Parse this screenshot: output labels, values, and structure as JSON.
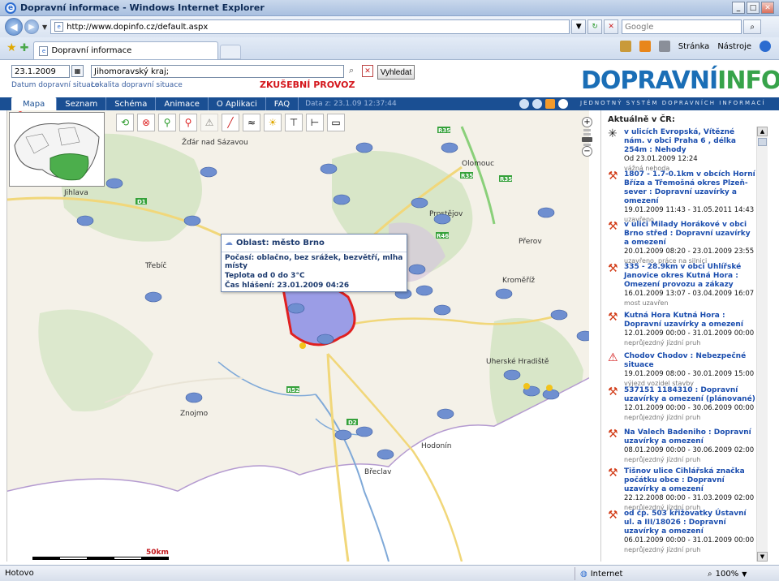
{
  "window": {
    "title": "Dopravní informace - Windows Internet Explorer"
  },
  "browser": {
    "url": "http://www.dopinfo.cz/default.aspx",
    "search_placeholder": "Google",
    "tab_title": "Dopravní informace",
    "cmd_page": "Stránka",
    "cmd_tools": "Nástroje"
  },
  "header": {
    "date_value": "23.1.2009",
    "date_label": "Datum dopravní situace",
    "location_value": "Jihomoravský kraj;",
    "location_label": "Lokalita dopravní situace",
    "trial_label": "ZKUŠEBNÍ PROVOZ",
    "search_button": "Vyhledat",
    "logo_part1": "DOPRAVNÍ",
    "logo_part2": "INFO"
  },
  "nav": {
    "tabs": [
      "Mapa",
      "Seznam",
      "Schéma",
      "Animace",
      "O Aplikaci",
      "FAQ"
    ],
    "date_text": "Data z: 23.1.09 12:37:44",
    "slogan": "JEDNOTNÝ SYSTÉM DOPRAVNÍCH INFORMACÍ"
  },
  "map": {
    "places": [
      {
        "name": "Žďár nad Sázavou"
      },
      {
        "name": "Olomouc"
      },
      {
        "name": "Jihlava"
      },
      {
        "name": "Prostějov"
      },
      {
        "name": "Přerov"
      },
      {
        "name": "Třebíč"
      },
      {
        "name": "Kroměříž"
      },
      {
        "name": "Uherské Hradiště"
      },
      {
        "name": "Znojmo"
      },
      {
        "name": "Hodonín"
      },
      {
        "name": "Břeclav"
      }
    ],
    "roads": [
      "D1",
      "R35",
      "R35",
      "R35",
      "R46",
      "R52",
      "D2"
    ],
    "scale_label": "50km"
  },
  "popup": {
    "title": "Oblast: město Brno",
    "lines": [
      "Počasí: oblačno, bez srážek, bezvětří, mlha místy",
      "Teplota od 0 do 3°C",
      "Čas hlášení: 23.01.2009 04:26"
    ]
  },
  "panel": {
    "title": "Aktuálně v ČR:",
    "items": [
      {
        "icon": "accident-icon",
        "head": "v ulicích Evropská, Vítězné nám. v obci Praha 6 , délka 254m : Nehody",
        "time": "Od 23.01.2009 12:24",
        "status": "vážná nehoda"
      },
      {
        "icon": "roadwork-icon",
        "head": "1807 - 1.7-0.1km v obcích Horní Bříza a Třemošná okres Plzeň-sever : Dopravní uzavírky a omezení",
        "time": "19.01.2009 11:43 - 31.05.2011 14:43",
        "status": "uzavřeno"
      },
      {
        "icon": "roadwork-icon",
        "head": "v ulici Milady Horákové v obci Brno střed : Dopravní uzavírky a omezení",
        "time": "20.01.2009 08:20 - 23.01.2009 23:55",
        "status": "uzavřeno, práce na silnici"
      },
      {
        "icon": "roadwork-icon",
        "head": "335 - 28.9km v obci Uhlířské Janovice okres Kutná Hora : Omezení provozu a zákazy",
        "time": "16.01.2009 13:07 - 03.04.2009 16:07",
        "status": "most uzavřen"
      },
      {
        "icon": "roadwork-icon",
        "head": "Kutná Hora Kutná Hora : Dopravní uzavírky a omezení",
        "time": "12.01.2009 00:00 - 31.01.2009 00:00",
        "status": "neprůjezdný jízdní pruh"
      },
      {
        "icon": "danger-icon",
        "head": "Chodov Chodov : Nebezpečné situace",
        "time": "19.01.2009 08:00 - 30.01.2009 15:00",
        "status": "výjezd vozidel stavby"
      },
      {
        "icon": "roadwork-icon",
        "head": "537151 1184310 : Dopravní uzavírky a omezení (plánované)",
        "time": "12.01.2009 00:00 - 30.06.2009 00:00",
        "status": "neprůjezdný jízdní pruh"
      },
      {
        "icon": "roadwork-icon",
        "head": "Na Valech Badeniho : Dopravní uzavírky a omezení",
        "time": "08.01.2009 00:00 - 30.06.2009 02:00",
        "status": "neprůjezdný jízdní pruh"
      },
      {
        "icon": "roadwork-icon",
        "head": "Tišnov ulice Cihlářská značka počátku obce : Dopravní uzavírky a omezení",
        "time": "22.12.2008 00:00 - 31.03.2009 02:00",
        "status": "neprůjezdný jízdní pruh"
      },
      {
        "icon": "roadwork-icon",
        "head": "od čp. 503 křižovatky Ústavní ul. a III/18026 : Dopravní uzavírky a omezení",
        "time": "06.01.2009 00:00 - 31.01.2009 00:00",
        "status": "neprůjezdný jízdní pruh"
      }
    ]
  },
  "status": {
    "text": "Hotovo",
    "zone": "Internet",
    "zoom": "100%"
  },
  "colors": {
    "nav": "#1a4f93",
    "logo_blue": "#1a6eb6",
    "logo_green": "#37a34a",
    "trial": "#d4161c",
    "link": "#1a4dae"
  }
}
